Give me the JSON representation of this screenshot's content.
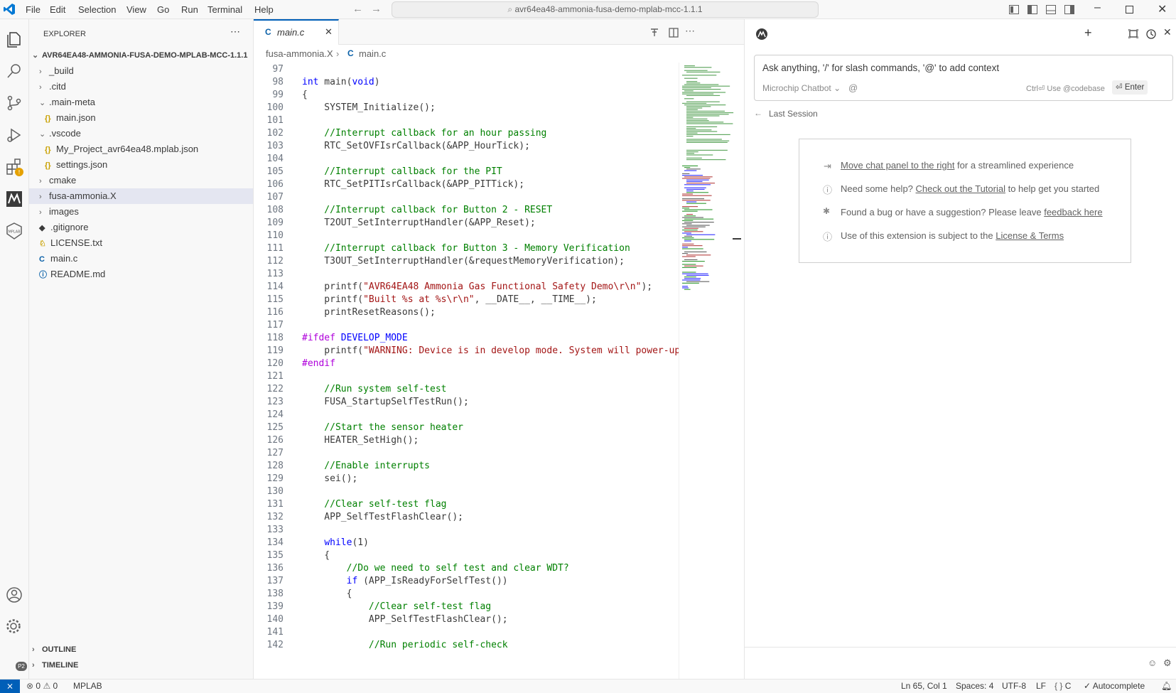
{
  "titlebar": {
    "menus": [
      "File",
      "Edit",
      "Selection",
      "View",
      "Go",
      "Run",
      "Terminal",
      "Help"
    ],
    "command_center": "avr64ea48-ammonia-fusa-demo-mplab-mcc-1.1.1"
  },
  "activity": {
    "badge": "P2"
  },
  "explorer": {
    "title": "EXPLORER",
    "root": "AVR64EA48-AMMONIA-FUSA-DEMO-MPLAB-MCC-1.1.1",
    "items": [
      {
        "label": "_build",
        "type": "folder"
      },
      {
        "label": ".citd",
        "type": "folder"
      },
      {
        "label": ".main-meta",
        "type": "folder-open"
      },
      {
        "label": "main.json",
        "type": "json"
      },
      {
        "label": ".vscode",
        "type": "folder-open"
      },
      {
        "label": "My_Project_avr64ea48.mplab.json",
        "type": "json"
      },
      {
        "label": "settings.json",
        "type": "json"
      },
      {
        "label": "cmake",
        "type": "folder"
      },
      {
        "label": "fusa-ammonia.X",
        "type": "folder"
      },
      {
        "label": "images",
        "type": "folder"
      },
      {
        "label": ".gitignore",
        "type": "git"
      },
      {
        "label": "LICENSE.txt",
        "type": "license"
      },
      {
        "label": "main.c",
        "type": "c"
      },
      {
        "label": "README.md",
        "type": "info"
      }
    ],
    "outline": "OUTLINE",
    "timeline": "TIMELINE"
  },
  "editor": {
    "tab": "main.c",
    "breadcrumb": [
      "fusa-ammonia.X",
      "main.c"
    ],
    "lines": [
      {
        "n": "97",
        "t": ""
      },
      {
        "n": "98",
        "t": "int main(void)"
      },
      {
        "n": "99",
        "t": "{"
      },
      {
        "n": "100",
        "t": "    SYSTEM_Initialize();"
      },
      {
        "n": "101",
        "t": ""
      },
      {
        "n": "102",
        "t": "    //Interrupt callback for an hour passing"
      },
      {
        "n": "103",
        "t": "    RTC_SetOVFIsrCallback(&APP_HourTick);"
      },
      {
        "n": "104",
        "t": ""
      },
      {
        "n": "105",
        "t": "    //Interrupt callback for the PIT"
      },
      {
        "n": "106",
        "t": "    RTC_SetPITIsrCallback(&APP_PITTick);"
      },
      {
        "n": "107",
        "t": ""
      },
      {
        "n": "108",
        "t": "    //Interrupt callback for Button 2 - RESET"
      },
      {
        "n": "109",
        "t": "    T2OUT_SetInterruptHandler(&APP_Reset);"
      },
      {
        "n": "110",
        "t": ""
      },
      {
        "n": "111",
        "t": "    //Interrupt callback for Button 3 - Memory Verification"
      },
      {
        "n": "112",
        "t": "    T3OUT_SetInterruptHandler(&requestMemoryVerification);"
      },
      {
        "n": "113",
        "t": ""
      },
      {
        "n": "114",
        "t": "    printf(\"AVR64EA48 Ammonia Gas Functional Safety Demo\\r\\n\");"
      },
      {
        "n": "115",
        "t": "    printf(\"Built %s at %s\\r\\n\", __DATE__, __TIME__);"
      },
      {
        "n": "116",
        "t": "    printResetReasons();"
      },
      {
        "n": "117",
        "t": ""
      },
      {
        "n": "118",
        "t": "#ifdef DEVELOP_MODE"
      },
      {
        "n": "119",
        "t": "    printf(\"WARNING: Device is in develop mode. System will power-up"
      },
      {
        "n": "120",
        "t": "#endif"
      },
      {
        "n": "121",
        "t": ""
      },
      {
        "n": "122",
        "t": "    //Run system self-test"
      },
      {
        "n": "123",
        "t": "    FUSA_StartupSelfTestRun();"
      },
      {
        "n": "124",
        "t": ""
      },
      {
        "n": "125",
        "t": "    //Start the sensor heater"
      },
      {
        "n": "126",
        "t": "    HEATER_SetHigh();"
      },
      {
        "n": "127",
        "t": ""
      },
      {
        "n": "128",
        "t": "    //Enable interrupts"
      },
      {
        "n": "129",
        "t": "    sei();"
      },
      {
        "n": "130",
        "t": ""
      },
      {
        "n": "131",
        "t": "    //Clear self-test flag"
      },
      {
        "n": "132",
        "t": "    APP_SelfTestFlashClear();"
      },
      {
        "n": "133",
        "t": ""
      },
      {
        "n": "134",
        "t": "    while(1)"
      },
      {
        "n": "135",
        "t": "    {"
      },
      {
        "n": "136",
        "t": "        //Do we need to self test and clear WDT?"
      },
      {
        "n": "137",
        "t": "        if (APP_IsReadyForSelfTest())"
      },
      {
        "n": "138",
        "t": "        {"
      },
      {
        "n": "139",
        "t": "            //Clear self-test flag"
      },
      {
        "n": "140",
        "t": "            APP_SelfTestFlashClear();"
      },
      {
        "n": "141",
        "t": ""
      },
      {
        "n": "142",
        "t": "            //Run periodic self-check"
      }
    ]
  },
  "chat": {
    "placeholder": "Ask anything, '/' for slash commands, '@' to add context",
    "model": "Microchip Chatbot",
    "at": "@",
    "hint_key": "Ctrl",
    "hint_text": "Use @codebase",
    "enter": "Enter",
    "last_session": "Last Session",
    "card": {
      "row1_link": "Move chat panel to the right",
      "row1_text": " for a streamlined experience",
      "row2_text": "Need some help? ",
      "row2_link": "Check out the Tutorial",
      "row2_tail": " to help get you started",
      "row3_text": "Found a bug or have a suggestion? Please leave ",
      "row3_link": "feedback here",
      "row4_text": "Use of this extension is subject to the ",
      "row4_link": "License & Terms"
    }
  },
  "statusbar": {
    "errors": "0",
    "warnings": "0",
    "mplab": "MPLAB",
    "position": "Ln 65, Col 1",
    "spaces": "Spaces: 4",
    "encoding": "UTF-8",
    "eol": "LF",
    "language": "C",
    "autocomplete": "Autocomplete"
  }
}
